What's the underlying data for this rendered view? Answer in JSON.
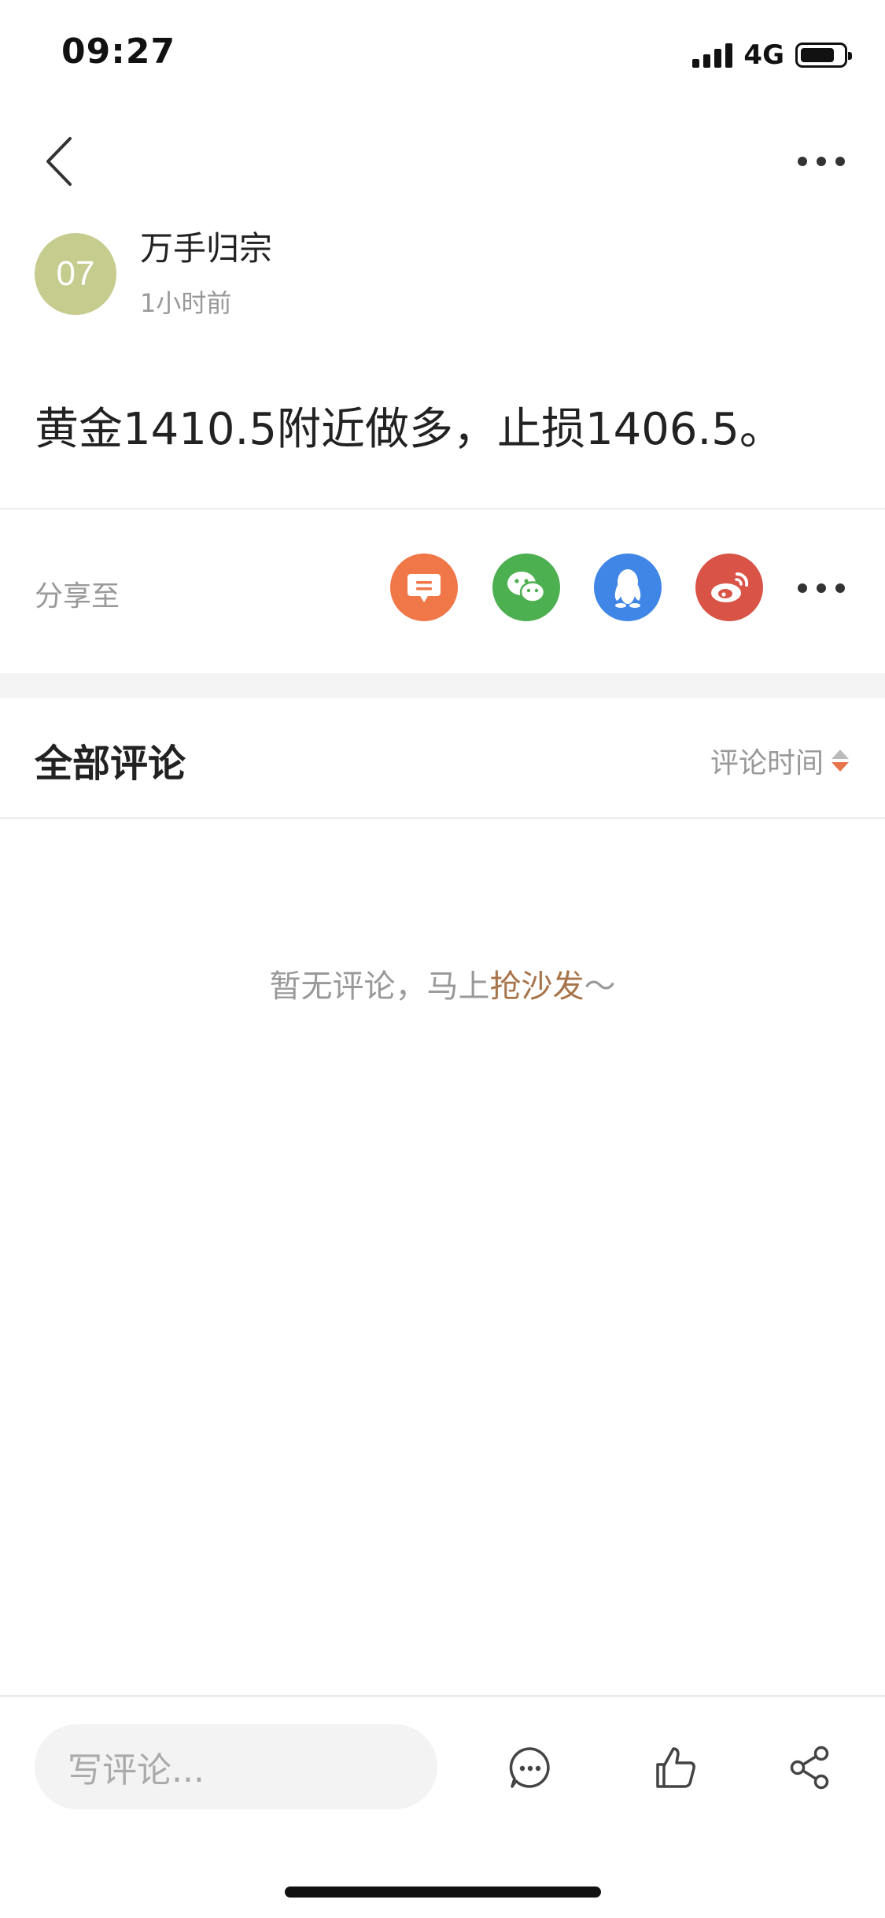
{
  "status_bar": {
    "time": "09:27",
    "network": "4G"
  },
  "nav": {
    "back_icon": "chevron-left-icon",
    "more_icon": "more-dots-icon"
  },
  "author": {
    "avatar_text": "07",
    "avatar_color": "#c5cc8e",
    "name": "万手归宗",
    "time_ago": "1小时前"
  },
  "post": {
    "content": "黄金1410.5附近做多，止损1406.5。"
  },
  "share": {
    "label": "分享至",
    "targets": [
      {
        "name": "message",
        "icon": "chat-bubble-icon",
        "color": "#ef7748"
      },
      {
        "name": "wechat",
        "icon": "wechat-icon",
        "color": "#4caf50"
      },
      {
        "name": "qq",
        "icon": "qq-penguin-icon",
        "color": "#3f86e6"
      },
      {
        "name": "weibo",
        "icon": "weibo-icon",
        "color": "#d95447"
      }
    ]
  },
  "comments": {
    "title": "全部评论",
    "sort_label": "评论时间",
    "empty_prefix": "暂无评论，马上",
    "empty_link": "抢沙发",
    "empty_suffix": "～"
  },
  "bottom_bar": {
    "input_placeholder": "写评论...",
    "icons": [
      "comment-icon",
      "thumbs-up-icon",
      "share-icon"
    ]
  },
  "colors": {
    "accent_link": "#a8744a",
    "sort_arrow_active": "#e7734a"
  }
}
